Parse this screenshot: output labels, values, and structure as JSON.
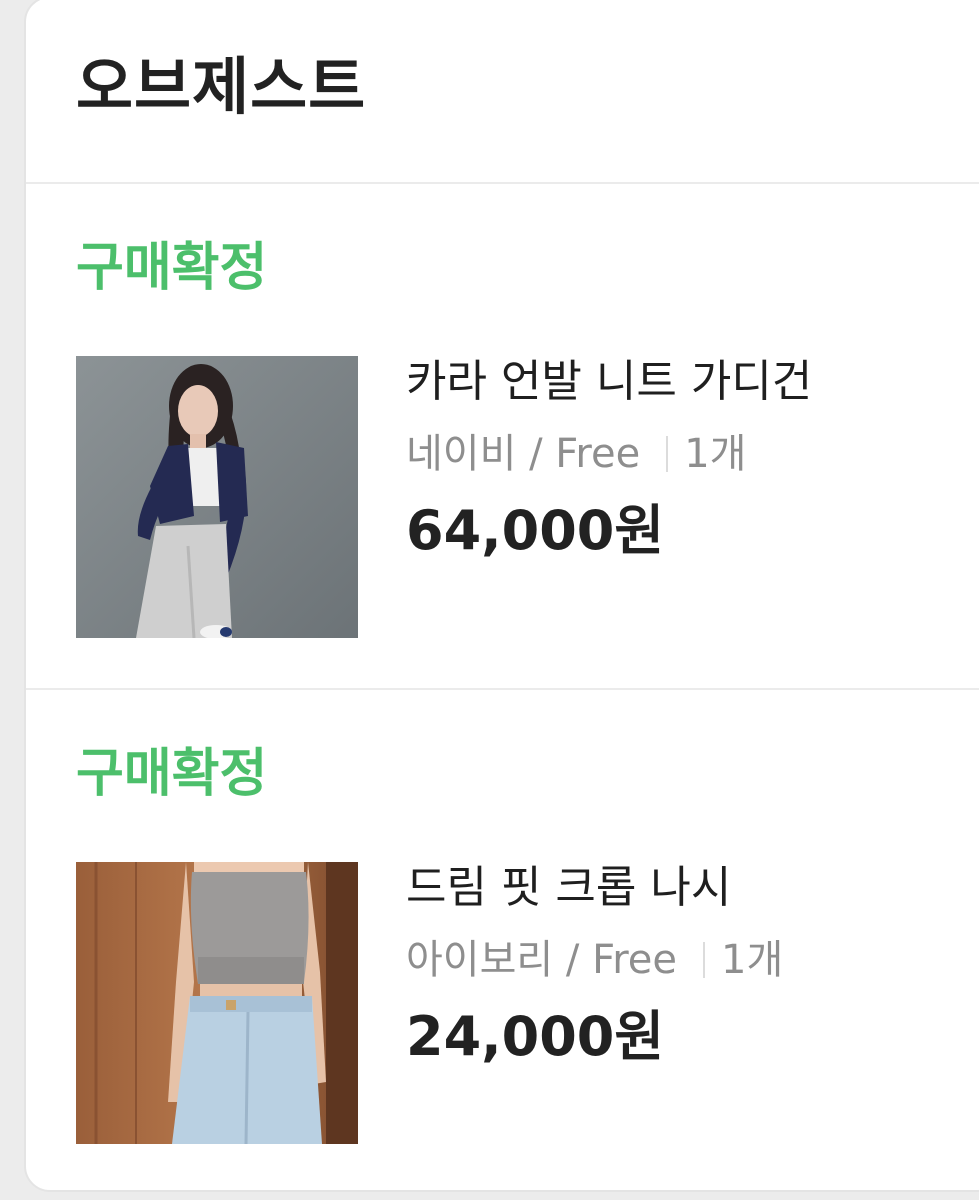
{
  "store": {
    "name": "오브제스트"
  },
  "orders": [
    {
      "status": "구매확정",
      "product_name": "카라 언발 니트 가디건",
      "option": "네이비 / Free",
      "quantity": "1개",
      "price": "64,000원",
      "image_icon": "product-photo-cardigan"
    },
    {
      "status": "구매확정",
      "product_name": "드림 핏 크롭 나시",
      "option": "아이보리 / Free",
      "quantity": "1개",
      "price": "24,000원",
      "image_icon": "product-photo-crop-top"
    }
  ],
  "colors": {
    "status_green": "#4cbf6b",
    "text_primary": "#222222",
    "text_secondary": "#8e8e8e"
  }
}
